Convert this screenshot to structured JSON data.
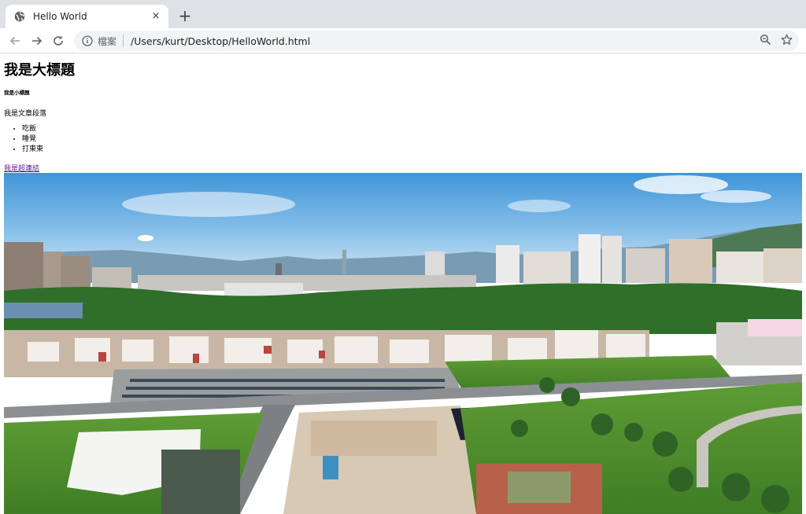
{
  "browser": {
    "tab_title": "Hello World",
    "tab_close": "×",
    "new_tab": "+",
    "scheme_label": "檔案",
    "url": "/Users/kurt/Desktop/HelloWorld.html"
  },
  "page": {
    "heading_big": "我是大標題",
    "heading_small": "我是小標題",
    "paragraph": "我是文章段落",
    "list_items": [
      "吃飯",
      "睡覺",
      "打東東"
    ],
    "link_text": "我是超連結",
    "image_alt": "panorama photo of a city with park and parking lot"
  },
  "icons": [
    "globe-icon",
    "back-icon",
    "forward-icon",
    "reload-icon",
    "info-icon",
    "zoom-icon",
    "bookmark-star-icon"
  ],
  "colors": {
    "chrome_bg": "#dee1e6",
    "omnibox_bg": "#f1f3f4",
    "link_visited": "#551a8b",
    "sky": "#5aa9e0",
    "vegetation": "#3f8a2e"
  }
}
